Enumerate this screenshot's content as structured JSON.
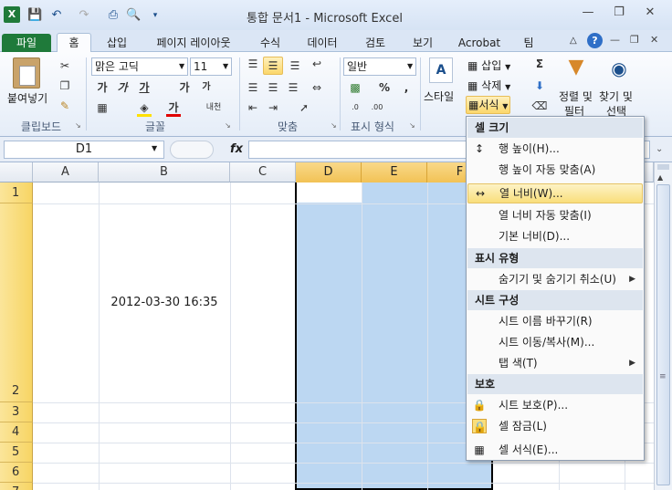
{
  "title": "통합 문서1 - Microsoft Excel",
  "tabs": [
    "파일",
    "홈",
    "삽입",
    "페이지 레이아웃",
    "수식",
    "데이터",
    "검토",
    "보기",
    "Acrobat",
    "팀"
  ],
  "ribbon": {
    "paste_label": "붙여넣기",
    "font_name": "맑은 고딕",
    "font_size": "11",
    "number_format": "일반",
    "style_label": "스타일",
    "insert_label": "삽입",
    "delete_label": "삭제",
    "format_label": "서식",
    "sort_label": "정렬 및",
    "sort_label2": "필터",
    "find_label": "찾기 및",
    "find_label2": "선택",
    "bold": "가",
    "italic": "가",
    "underline": "가",
    "grow": "가",
    "shrink": "가",
    "fontcolor": "가",
    "phonetic": "내천",
    "percent": "%",
    "comma": ",",
    "groups": {
      "clipboard": "클립보드",
      "font": "글꼴",
      "align": "맞춤",
      "number": "표시 형식"
    }
  },
  "formula_bar": {
    "name_box": "D1",
    "fx": "fx",
    "formula": ""
  },
  "sheet": {
    "columns": [
      "A",
      "B",
      "C",
      "D",
      "E",
      "F"
    ],
    "rows": [
      "1",
      "2",
      "3",
      "4",
      "5",
      "6",
      "7"
    ],
    "cell_B2": "2012-03-30 16:35"
  },
  "menu": {
    "h1": "셀 크기",
    "row_height": "행 높이(H)...",
    "autofit_row": "행 높이 자동 맞춤(A)",
    "col_width": "열 너비(W)...",
    "autofit_col": "열 너비 자동 맞춤(I)",
    "default_width": "기본 너비(D)...",
    "h2": "표시 유형",
    "hide_unhide": "숨기기 및 숨기기 취소(U)",
    "h3": "시트 구성",
    "rename": "시트 이름 바꾸기(R)",
    "move_copy": "시트 이동/복사(M)...",
    "tab_color": "탭 색(T)",
    "h4": "보호",
    "protect": "시트 보호(P)...",
    "lock": "셀 잠금(L)",
    "format_cells": "셀 서식(E)..."
  },
  "colors": {
    "accent": "#1f7a3a",
    "selection": "#bcd7f2",
    "header_sel": "#f7d564",
    "highlight": "#f9de7b"
  }
}
